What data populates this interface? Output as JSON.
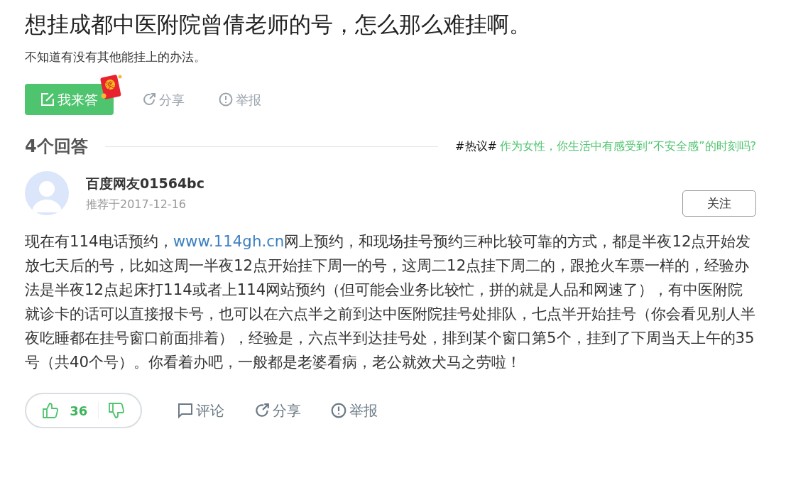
{
  "question": {
    "title": "想挂成都中医附院曾倩老师的号，怎么那么难挂啊。",
    "description": "不知道有没有其他能挂上的办法。"
  },
  "question_actions": [
    {
      "kind": "answer",
      "label": "我来答",
      "badge": "奖"
    },
    {
      "kind": "share",
      "label": "分享"
    },
    {
      "kind": "report",
      "label": "举报"
    }
  ],
  "answers_header": {
    "count": "4个回答",
    "topic_tag": "#热议#",
    "topic": "作为女性，你生活中有感受到“不安全感”的时刻吗?"
  },
  "answer": {
    "author": "百度网友01564bc",
    "date": "推荐于2017-12-16",
    "follow_button": "关注",
    "body": [
      {
        "kind": "text",
        "text": "现在有114电话预约，"
      },
      {
        "kind": "link",
        "text": "www.114gh.cn"
      },
      {
        "kind": "text",
        "text": "网上预约，和现场挂号预约三种比较可靠的方式，都是半夜12点开始发放七天后的号，比如这周一半夜12点开始挂下周一的号，这周二12点挂下周二的，跟抢火车票一样的，经验办法是半夜12点起床打114或者上114网站预约（但可能会业务比较忙，拼的就是人品和网速了），有中医附院就诊卡的话可以直接报卡号，也可以在六点半之前到达中医附院挂号处排队，七点半开始挂号（你会看见别人半夜吃睡都在挂号窗口前面排着），经验是，六点半到达挂号处，排到某个窗口第5个，挂到了下周当天上午的35号（共40个号）。你看着办吧，一般都是老婆看病，老公就效犬马之劳啦！"
      }
    ],
    "likes": "36",
    "actions": [
      {
        "kind": "comment",
        "label": "评论"
      },
      {
        "kind": "share",
        "label": "分享"
      },
      {
        "kind": "report",
        "label": "举报"
      }
    ]
  }
}
